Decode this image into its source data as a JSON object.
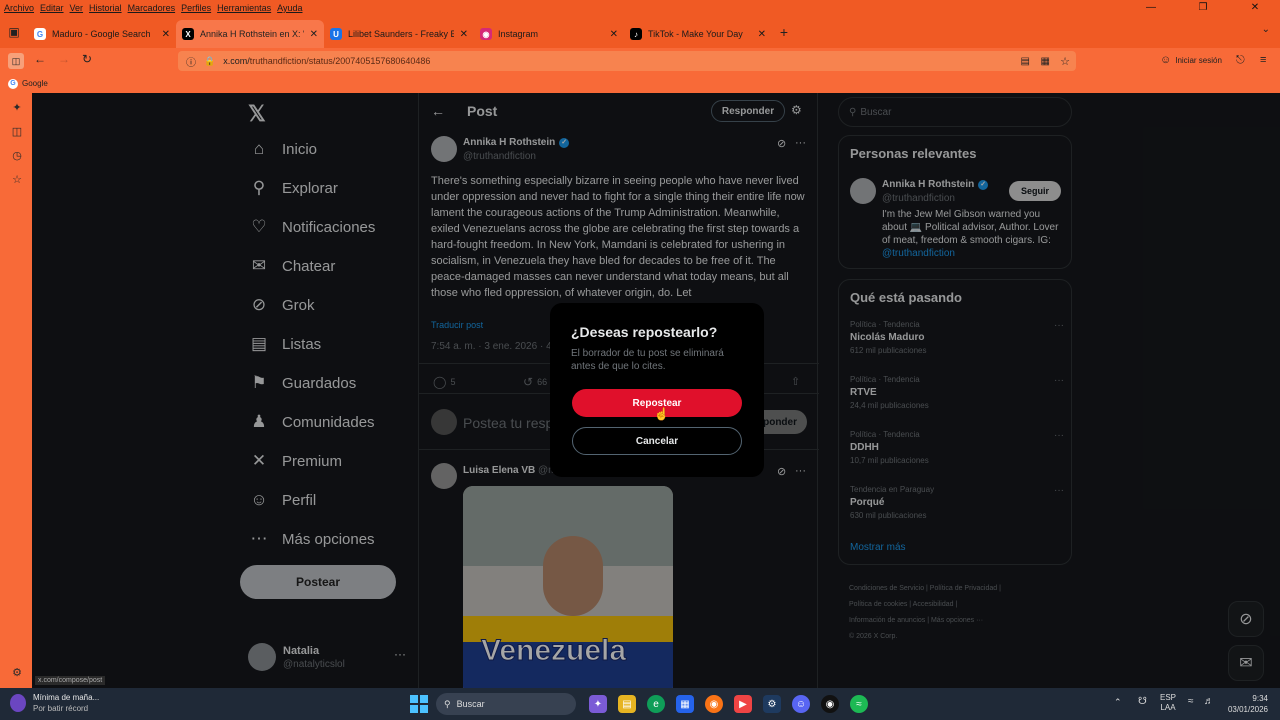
{
  "menubar": {
    "items": [
      "Archivo",
      "Editar",
      "Ver",
      "Historial",
      "Marcadores",
      "Perfiles",
      "Herramientas",
      "Ayuda"
    ]
  },
  "tabs": [
    {
      "label": "Maduro - Google Search",
      "icon": "google-icon",
      "color": "#ffffff"
    },
    {
      "label": "Annika H Rothstein en X: \"There",
      "icon": "x-icon",
      "color": "#000000"
    },
    {
      "label": "Lilibet Saunders - Freaky Baddie",
      "icon": "shield-icon",
      "color": "#1a73e8"
    },
    {
      "label": "Instagram",
      "icon": "instagram-icon",
      "color": "#d62976"
    },
    {
      "label": "TikTok - Make Your Day",
      "icon": "tiktok-icon",
      "color": "#000000"
    }
  ],
  "address": {
    "url_host": "x.com/",
    "url_path": "truthandfiction/status/2007405157680640486",
    "login": "Iniciar sesión"
  },
  "bookmarks": {
    "google": "Google"
  },
  "nav": {
    "items": [
      {
        "label": "Inicio",
        "icon": "home-icon"
      },
      {
        "label": "Explorar",
        "icon": "search-icon"
      },
      {
        "label": "Notificaciones",
        "icon": "bell-icon"
      },
      {
        "label": "Chatear",
        "icon": "mail-icon"
      },
      {
        "label": "Grok",
        "icon": "grok-icon"
      },
      {
        "label": "Listas",
        "icon": "list-icon"
      },
      {
        "label": "Guardados",
        "icon": "bookmark-icon"
      },
      {
        "label": "Comunidades",
        "icon": "communities-icon"
      },
      {
        "label": "Premium",
        "icon": "x-icon"
      },
      {
        "label": "Perfil",
        "icon": "person-icon"
      },
      {
        "label": "Más opciones",
        "icon": "more-circle-icon"
      }
    ],
    "post_button": "Postear"
  },
  "user": {
    "name": "Natalia",
    "handle": "@natalyticslol"
  },
  "timeline": {
    "header": "Post",
    "reply_button": "Responder",
    "post": {
      "author": "Annika H Rothstein",
      "handle": "@truthandfiction",
      "text": "There's something especially bizarre in seeing people who have never lived under oppression and never had to fight for a single thing their entire life now lament the courageous actions of the Trump Administration. Meanwhile, exiled Venezuelans across the globe are celebrating the first step towards a hard-fought freedom. In New York, Mamdani is celebrated for ushering in socialism, in Venezuela they have bled for decades to be free of it. The peace-damaged masses can never understand what today means, but all those who fled oppression, of whatever origin, do. Let",
      "translate": "Traducir post",
      "time": "7:54 a. m. · 3 ene. 2026 · 4",
      "replies": "5",
      "reposts": "66"
    },
    "compose_placeholder": "Postea tu resp",
    "compose_button": "ponder",
    "reply_author": "Luisa Elena VB",
    "reply_handle": "@m",
    "image_text": "Venezuela"
  },
  "search": {
    "placeholder": "Buscar"
  },
  "relevant": {
    "title": "Personas relevantes",
    "name": "Annika H Rothstein",
    "handle": "@truthandfiction",
    "follow": "Seguir",
    "bio": "I'm the Jew Mel Gibson warned you about 💻 Political advisor, Author. Lover of meat, freedom & smooth cigars. IG: ",
    "bio_link": "@truthandfiction"
  },
  "trends": {
    "title": "Qué está pasando",
    "items": [
      {
        "category": "Política · Tendencia",
        "name": "Nicolás Maduro",
        "count": "612 mil publicaciones"
      },
      {
        "category": "Política · Tendencia",
        "name": "RTVE",
        "count": "24,4 mil publicaciones"
      },
      {
        "category": "Política · Tendencia",
        "name": "DDHH",
        "count": "10,7 mil publicaciones"
      },
      {
        "category": "Tendencia en Paraguay",
        "name": "Porqué",
        "count": "630 mil publicaciones"
      }
    ],
    "more": "Mostrar más"
  },
  "footer": {
    "lines": [
      "Condiciones de Servicio  |  Política de Privacidad  |",
      "Política de cookies  |  Accesibilidad  |",
      "Información de anuncios  |  Más opciones ···",
      "© 2026 X Corp."
    ]
  },
  "modal": {
    "title": "¿Deseas repostearlo?",
    "body": "El borrador de tu post se eliminará antes de que lo cites.",
    "confirm": "Repostear",
    "cancel": "Cancelar"
  },
  "status_url": "x.com/compose/post",
  "taskbar": {
    "weather_title": "Mínima de maña...",
    "weather_sub": "Por batir récord",
    "search": "Buscar",
    "lang1": "ESP",
    "lang2": "LAA",
    "time": "9:34",
    "date": "03/01/2026"
  }
}
